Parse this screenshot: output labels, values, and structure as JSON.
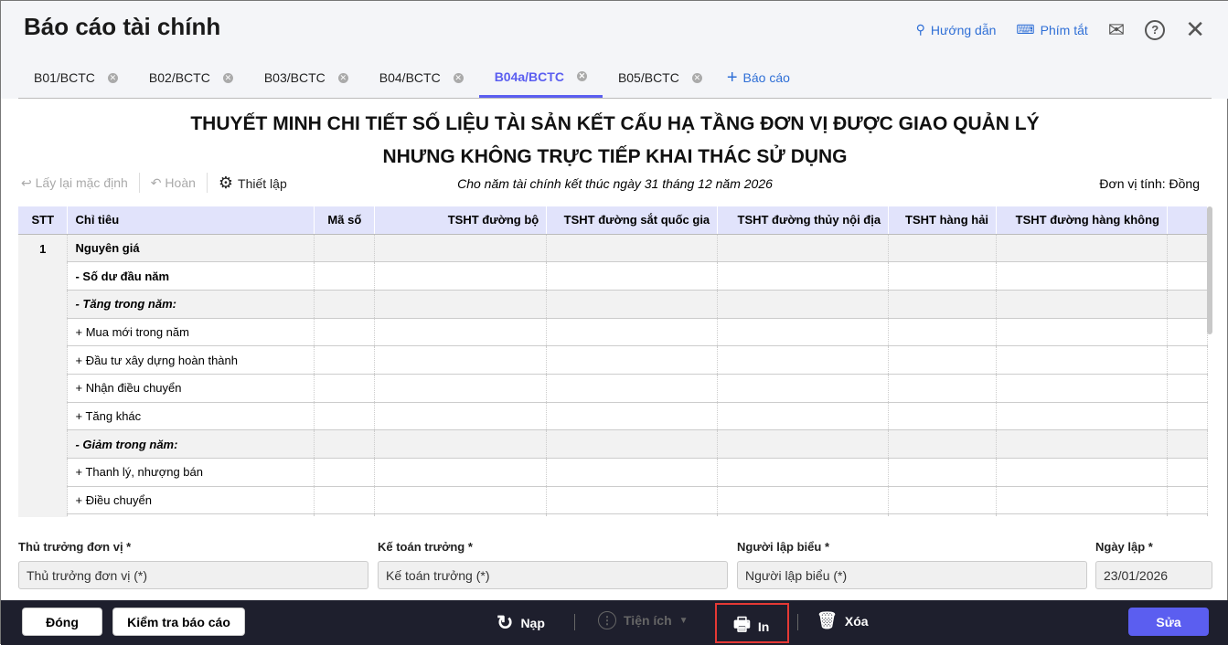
{
  "app": {
    "title": "Báo cáo tài chính",
    "help": "Hướng dẫn",
    "shortcuts": "Phím tắt"
  },
  "tabs": [
    {
      "label": "B01/BCTC"
    },
    {
      "label": "B02/BCTC"
    },
    {
      "label": "B03/BCTC"
    },
    {
      "label": "B04/BCTC"
    },
    {
      "label": "B04a/BCTC",
      "active": true
    },
    {
      "label": "B05/BCTC"
    }
  ],
  "add_tab": "Báo cáo",
  "report": {
    "title1": "THUYẾT MINH CHI TIẾT SỐ LIỆU TÀI SẢN KẾT CẤU HẠ TẦNG ĐƠN VỊ ĐƯỢC GIAO QUẢN LÝ",
    "title2": "NHƯNG KHÔNG TRỰC TIẾP KHAI THÁC SỬ DỤNG",
    "subtitle": "Cho năm tài chính kết thúc ngày 31 tháng 12 năm 2026",
    "unit": "Đơn vị tính: Đồng"
  },
  "toolbar": {
    "reset": "Lấy lại mặc định",
    "undo": "Hoàn",
    "settings": "Thiết lập"
  },
  "table": {
    "headers": [
      "STT",
      "Chỉ tiêu",
      "Mã số",
      "TSHT đường bộ",
      "TSHT đường sắt quốc gia",
      "TSHT đường thủy nội địa",
      "TSHT hàng hải",
      "TSHT đường hàng không"
    ],
    "stt": "1",
    "rows": [
      {
        "label": "Nguyên giá",
        "style": "bold",
        "gray": true
      },
      {
        "label": "- Số dư đầu năm",
        "style": "bold"
      },
      {
        "label": "- Tăng trong năm:",
        "style": "bolditalic",
        "gray": true
      },
      {
        "label": "+ Mua mới trong năm"
      },
      {
        "label": "+ Đầu tư xây dựng hoàn thành"
      },
      {
        "label": "+ Nhận điều chuyển"
      },
      {
        "label": "+ Tăng khác"
      },
      {
        "label": "- Giảm trong năm:",
        "style": "bolditalic",
        "gray": true
      },
      {
        "label": "+ Thanh lý, nhượng bán"
      },
      {
        "label": "+ Điều chuyển"
      },
      {
        "label": ""
      }
    ]
  },
  "signers": {
    "head_label": "Thủ trưởng đơn vị *",
    "head_value": "Thủ trưởng đơn vị (*)",
    "acct_label": "Kế toán trưởng *",
    "acct_value": "Kế toán trưởng (*)",
    "maker_label": "Người lập biểu *",
    "maker_value": "Người lập biểu (*)",
    "date_label": "Ngày lập *",
    "date_value": "23/01/2026"
  },
  "footer": {
    "close": "Đóng",
    "check": "Kiểm tra báo cáo",
    "reload": "Nạp",
    "utilities": "Tiện ích",
    "print": "In",
    "delete": "Xóa",
    "edit": "Sửa"
  },
  "colors": {
    "accent": "#5b5ef0",
    "bar": "#1e1f2d",
    "highlight": "#e53935"
  }
}
